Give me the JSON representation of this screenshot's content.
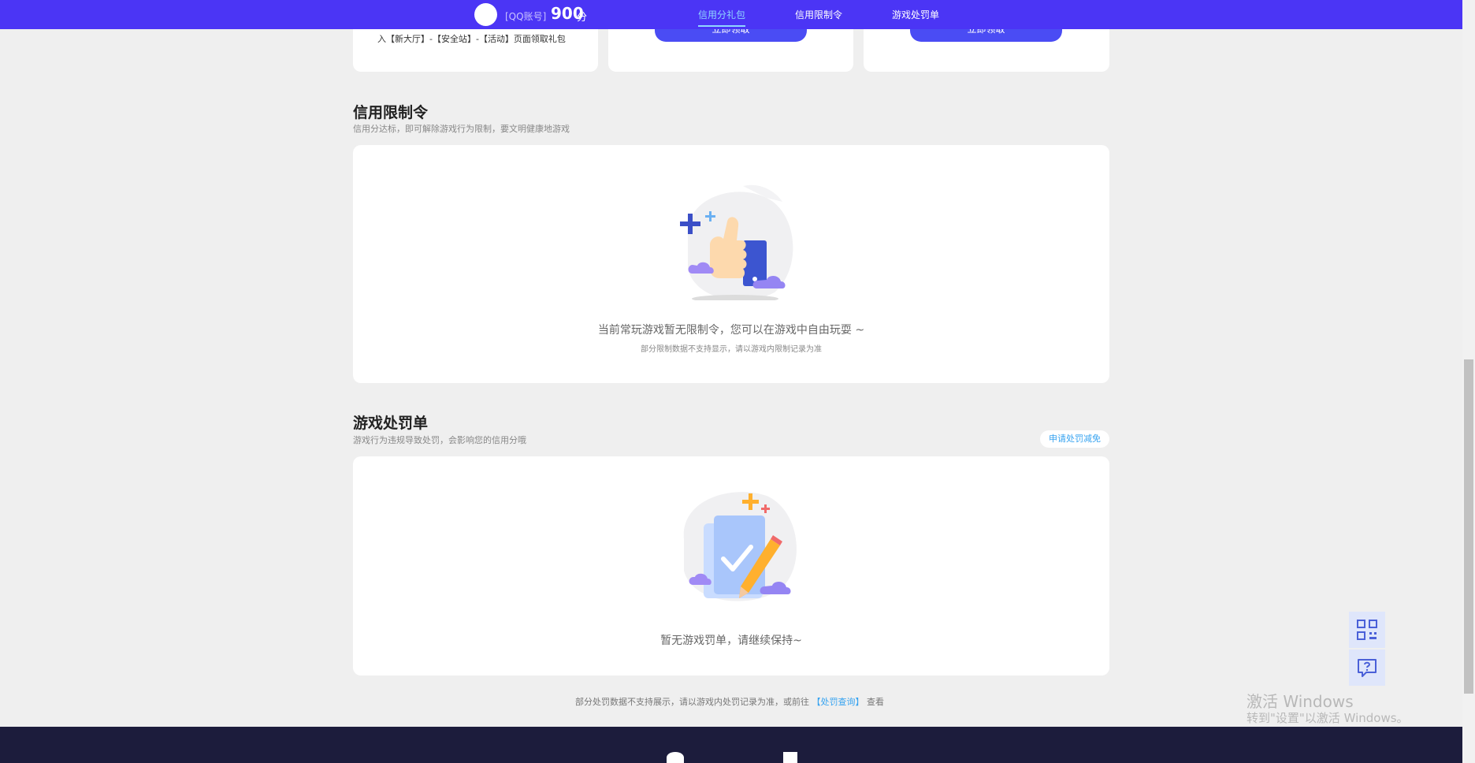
{
  "topbar": {
    "account_label": "[QQ账号]",
    "score": "900",
    "score_unit": "分",
    "nav": [
      {
        "label": "信用分礼包",
        "active": true
      },
      {
        "label": "信用限制令",
        "active": false
      },
      {
        "label": "游戏处罚单",
        "active": false
      }
    ]
  },
  "gift_section": {
    "card1_text": "入【新大厅】-【安全站】-【活动】页面领取礼包",
    "claim_label": "立即领取"
  },
  "restriction": {
    "title": "信用限制令",
    "subtitle": "信用分达标，即可解除游戏行为限制，要文明健康地游戏",
    "empty_text": "当前常玩游戏暂无限制令，您可以在游戏中自由玩耍 ~",
    "empty_note": "部分限制数据不支持显示，请以游戏内限制记录为准"
  },
  "penalty": {
    "title": "游戏处罚单",
    "subtitle": "游戏行为违规导致处罚，会影响您的信用分哦",
    "apply_button": "申请处罚减免",
    "empty_text": "暂无游戏罚单，请继续保持~"
  },
  "footnote": {
    "before": "部分处罚数据不支持展示，请以游戏内处罚记录为准，或前往",
    "link": "【处罚查询】",
    "after": "查看"
  },
  "watermark": {
    "line1": "激活 Windows",
    "line2": "转到\"设置\"以激活 Windows。"
  },
  "icons": [
    "qrcode-icon",
    "help-chat-icon",
    "wechat-icon",
    "mail-icon"
  ],
  "colors": {
    "brand": "#4b35f5",
    "accent_blue": "#4a4cf4",
    "link": "#36a3f0",
    "footer": "#1c1c3c"
  }
}
